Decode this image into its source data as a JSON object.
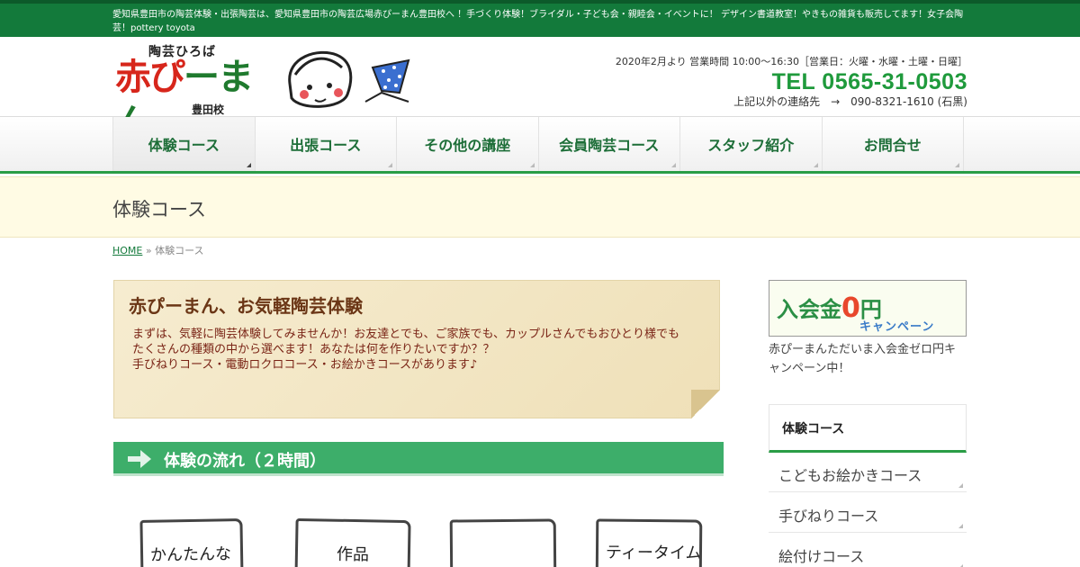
{
  "topbar": {
    "text": "愛知県豊田市の陶芸体験・出張陶芸は、愛知県豊田市の陶芸広場赤ぴーまん豊田校へ ！手づくり体験！ブライダル・子ども会・親睦会・イベントに！ デザイン書道教室！やきもの雑貨も販売してます！女子会陶芸！pottery toyota"
  },
  "logo": {
    "tagline": "陶芸ひろば",
    "name_red": "赤ぴ",
    "name_green": "ーまん",
    "branch": "豊田校"
  },
  "header_info": {
    "hours": "2020年2月より 営業時間 10:00～16:30［営業日：火曜・水曜・土曜・日曜］",
    "tel": "TEL 0565-31-0503",
    "alt_contact": "上記以外の連絡先　→　090-8321-1610 (石黒)"
  },
  "nav": {
    "items": [
      {
        "label": "体験コース",
        "active": true
      },
      {
        "label": "出張コース",
        "active": false
      },
      {
        "label": "その他の講座",
        "active": false
      },
      {
        "label": "会員陶芸コース",
        "active": false
      },
      {
        "label": "スタッフ紹介",
        "active": false
      },
      {
        "label": "お問合せ",
        "active": false
      }
    ]
  },
  "page": {
    "title": "体験コース",
    "breadcrumb_home": "HOME",
    "breadcrumb_sep": " » ",
    "breadcrumb_current": "体験コース"
  },
  "intro": {
    "heading": "赤ぴーまん、お気軽陶芸体験",
    "lines": [
      "まずは、気軽に陶芸体験してみませんか！お友達とでも、ご家族でも、カップルさんでもおひとり様でも",
      "たくさんの種類の中から選べます！あなたは何を作りたいですか？？",
      "手びねりコース・電動ロクロコース・お絵かきコースがあります♪"
    ]
  },
  "flow": {
    "heading": "体験の流れ（２時間）",
    "cards": [
      "かんたんな",
      "作品",
      "",
      "ティータイム"
    ]
  },
  "sidebar": {
    "banner_main": "入会金",
    "banner_zero": "0",
    "banner_yen": "円",
    "banner_sub": "キャンペーン",
    "campaign_text": "赤ぴーまんただいま入会金ゼロ円キャンペーン中！",
    "section_title": "体験コース",
    "items": [
      "こどもお絵かきコース",
      "手びねりコース",
      "絵付けコース"
    ]
  },
  "colors": {
    "topbar": "#137a3b",
    "accent_green": "#2a9d46",
    "tel_green": "#1f9a3c",
    "brand_red": "#d7261b",
    "band": "#fffbe4",
    "intro_text": "#7a2416"
  }
}
